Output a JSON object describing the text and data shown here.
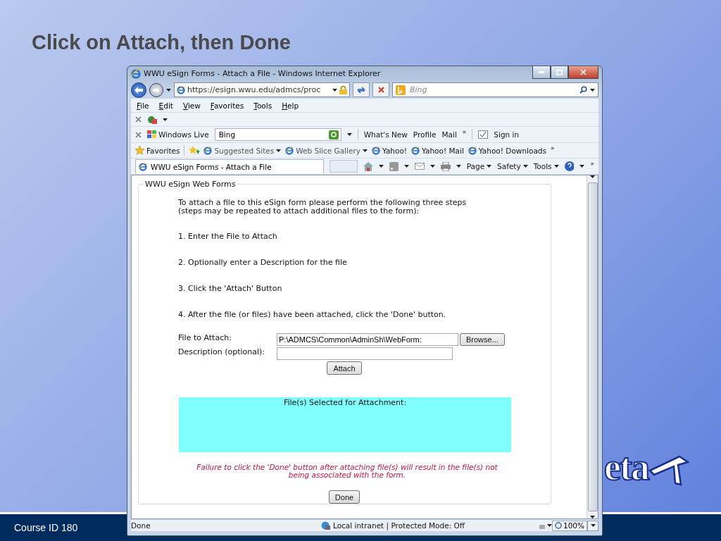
{
  "slide": {
    "title": "Click on Attach, then Done",
    "footer": "Course ID 180",
    "logo": "eta"
  },
  "browser": {
    "title": "WWU eSign Forms - Attach a File - Windows Internet Explorer",
    "url": "https://esign.wwu.edu/admcs/proc",
    "search_placeholder": "Bing",
    "menu": [
      "File",
      "Edit",
      "View",
      "Favorites",
      "Tools",
      "Help"
    ],
    "live": {
      "label": "Windows Live",
      "search_value": "Bing",
      "links": [
        "What's New",
        "Profile",
        "Mail"
      ],
      "more": "»",
      "sign_in": "Sign in"
    },
    "favorites": {
      "label": "Favorites",
      "more": "»",
      "items": [
        {
          "label": "Suggested Sites",
          "dropdown": true
        },
        {
          "label": "Web Slice Gallery",
          "dropdown": true
        },
        {
          "label": "Yahoo!",
          "dropdown": false
        },
        {
          "label": "Yahoo! Mail",
          "dropdown": false
        },
        {
          "label": "Yahoo! Downloads",
          "dropdown": false
        }
      ]
    },
    "tab": "WWU eSign Forms - Attach a File",
    "commands": [
      "Page",
      "Safety",
      "Tools"
    ],
    "commands_more": "»",
    "content": {
      "legend": "WWU eSign Web Forms",
      "intro": [
        "To attach a file to this eSign form please perform the following three steps",
        "(steps may be repeated to attach additional files to the form):"
      ],
      "steps": [
        "1. Enter the File to Attach",
        "2. Optionally enter a Description for the file",
        "3. Click the 'Attach' Button",
        "4. After the file (or files) have been attached, click the 'Done' button."
      ],
      "file_label": "File to Attach:",
      "file_value": "P:\\ADMCS\\Common\\AdminSh\\WebForm:",
      "browse": "Browse...",
      "description_label": "Description (optional):",
      "attach": "Attach",
      "selected_heading": "File(s) Selected for Attachment:",
      "warning": [
        "Failure to click the 'Done' button after attaching file(s) will result in the file(s) not",
        "being associated with the form."
      ],
      "done": "Done"
    },
    "status": {
      "text": "Done",
      "zone": "Local intranet | Protected Mode: Off",
      "zoom": "100%"
    }
  }
}
